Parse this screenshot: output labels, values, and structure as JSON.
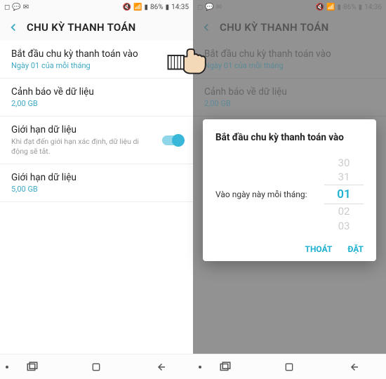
{
  "left": {
    "status": {
      "battery": "86%",
      "time": "14:35"
    },
    "header": {
      "title": "CHU KỲ THANH TOÁN"
    },
    "items": {
      "start": {
        "title": "Bắt đầu chu kỳ thanh toán vào",
        "sub": "Ngày 01 của mỗi tháng"
      },
      "warn": {
        "title": "Cảnh báo về dữ liệu",
        "sub": "2,00 GB"
      },
      "limit_toggle": {
        "title": "Giới hạn dữ liệu",
        "desc": "Khi đạt đến giới hạn xác định, dữ liệu di động sẽ tắt."
      },
      "limit_value": {
        "title": "Giới hạn dữ liệu",
        "sub": "5,00 GB"
      }
    }
  },
  "right": {
    "status": {
      "battery": "86%",
      "time": "14:36"
    },
    "header": {
      "title": "CHU KỲ THANH TOÁN"
    },
    "items": {
      "start": {
        "title": "Bắt đầu chu kỳ thanh toán vào",
        "sub": "Ngày 01 của mỗi tháng"
      },
      "warn": {
        "title": "Cảnh báo về dữ liệu",
        "sub": "2,00 GB"
      }
    },
    "dialog": {
      "title": "Bắt đầu chu kỳ thanh toán vào",
      "label": "Vào ngày này mỗi tháng:",
      "wheel": {
        "p2": "30",
        "p1": "31",
        "sel": "01",
        "n1": "02",
        "n2": "03"
      },
      "cancel": "THOÁT",
      "ok": "ĐẶT"
    }
  }
}
